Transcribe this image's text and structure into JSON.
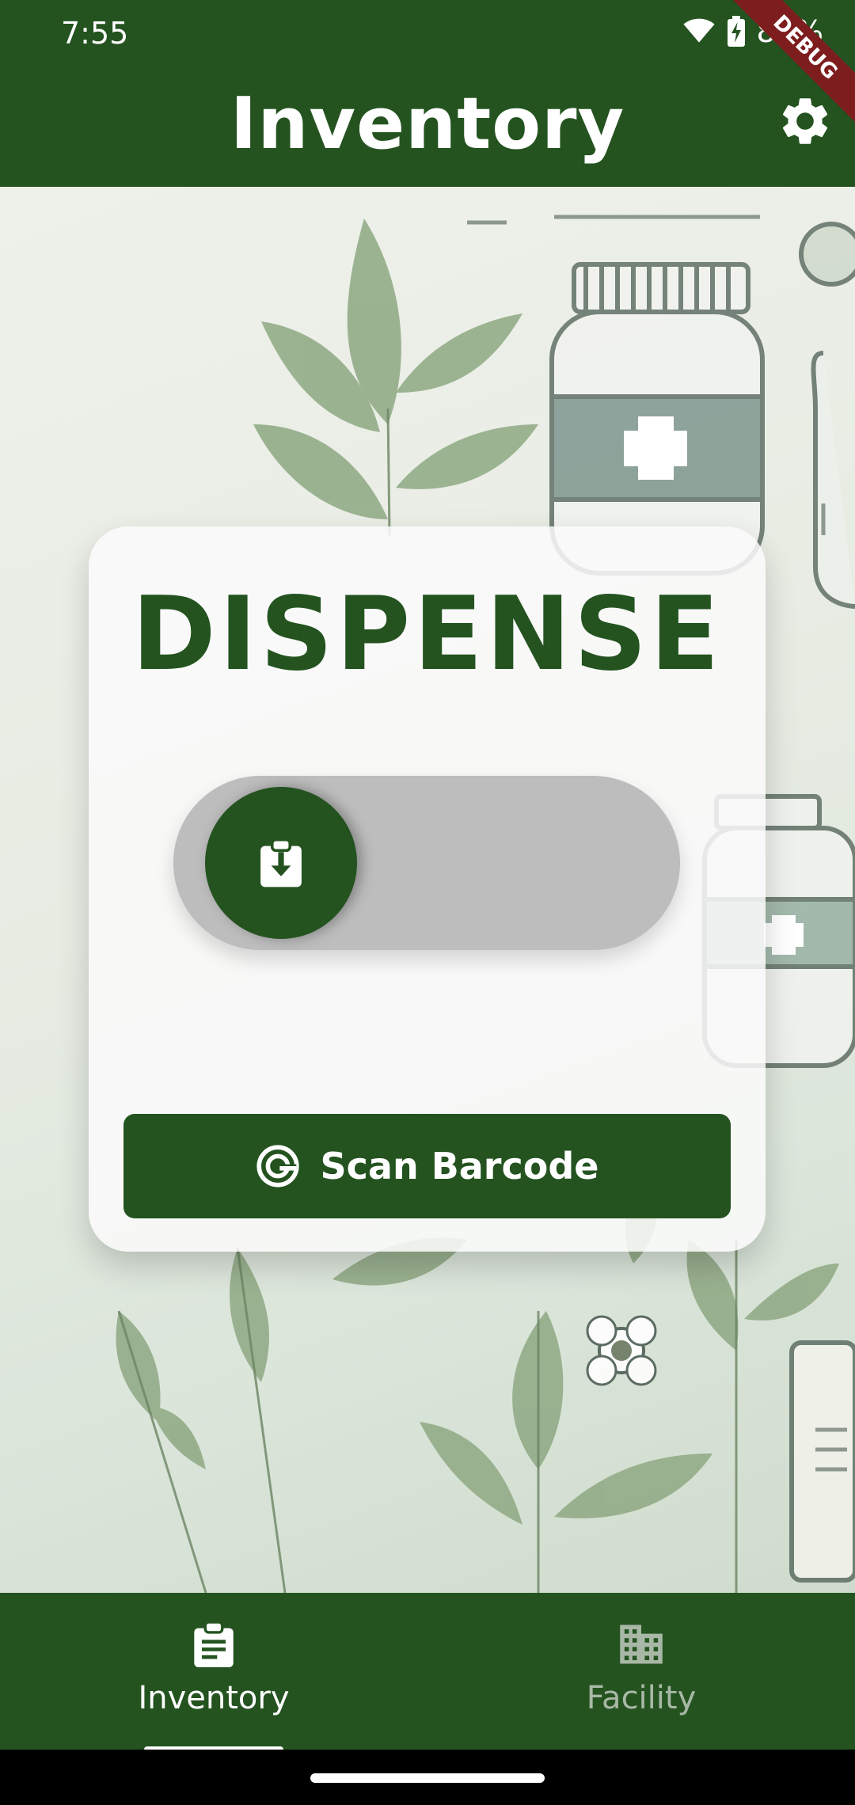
{
  "status_bar": {
    "time": "7:55",
    "battery": "86%",
    "debug_banner": "DEBUG"
  },
  "app_bar": {
    "title": "Inventory",
    "settings_icon": "gear-icon"
  },
  "card": {
    "title": "DISPENSE",
    "slider_icon": "clipboard-download-icon",
    "scan_button_label": "Scan Barcode",
    "scan_icon": "target-scan-icon"
  },
  "bottom_nav": {
    "items": [
      {
        "label": "Inventory",
        "icon": "clipboard-icon",
        "selected": true
      },
      {
        "label": "Facility",
        "icon": "building-icon",
        "selected": false
      }
    ]
  },
  "colors": {
    "primary": "#245320",
    "card": "#fafafa",
    "slider_track": "#bdbdbd",
    "nav_inactive": "#a9b8a6",
    "debug": "#7d1d1d"
  }
}
